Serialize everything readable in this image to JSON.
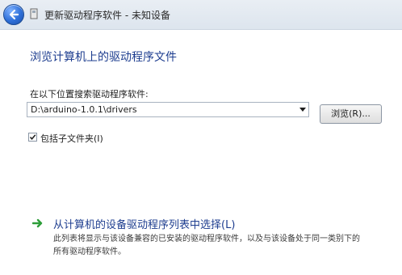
{
  "window": {
    "title": "更新驱动程序软件 - 未知设备"
  },
  "page": {
    "heading": "浏览计算机上的驱动程序文件",
    "search_label": "在以下位置搜索驱动程序软件:",
    "path_value": "D:\\arduino-1.0.1\\drivers",
    "browse_label": "浏览(R)...",
    "include_subfolders_label": "包括子文件夹(I)",
    "include_subfolders_checked": true
  },
  "option": {
    "title": "从计算机的设备驱动程序列表中选择(L)",
    "desc_line1": "此列表将显示与该设备兼容的已安装的驱动程序软件，以及与该设备处于同一类别下的",
    "desc_line2": "所有驱动程序软件。"
  },
  "icons": {
    "back": "back-arrow-icon",
    "window": "device-icon",
    "option_arrow": "green-arrow-icon"
  },
  "colors": {
    "heading": "#1d3d8f",
    "back_button": "#2e6fd8",
    "option_arrow": "#2e9e3a"
  }
}
